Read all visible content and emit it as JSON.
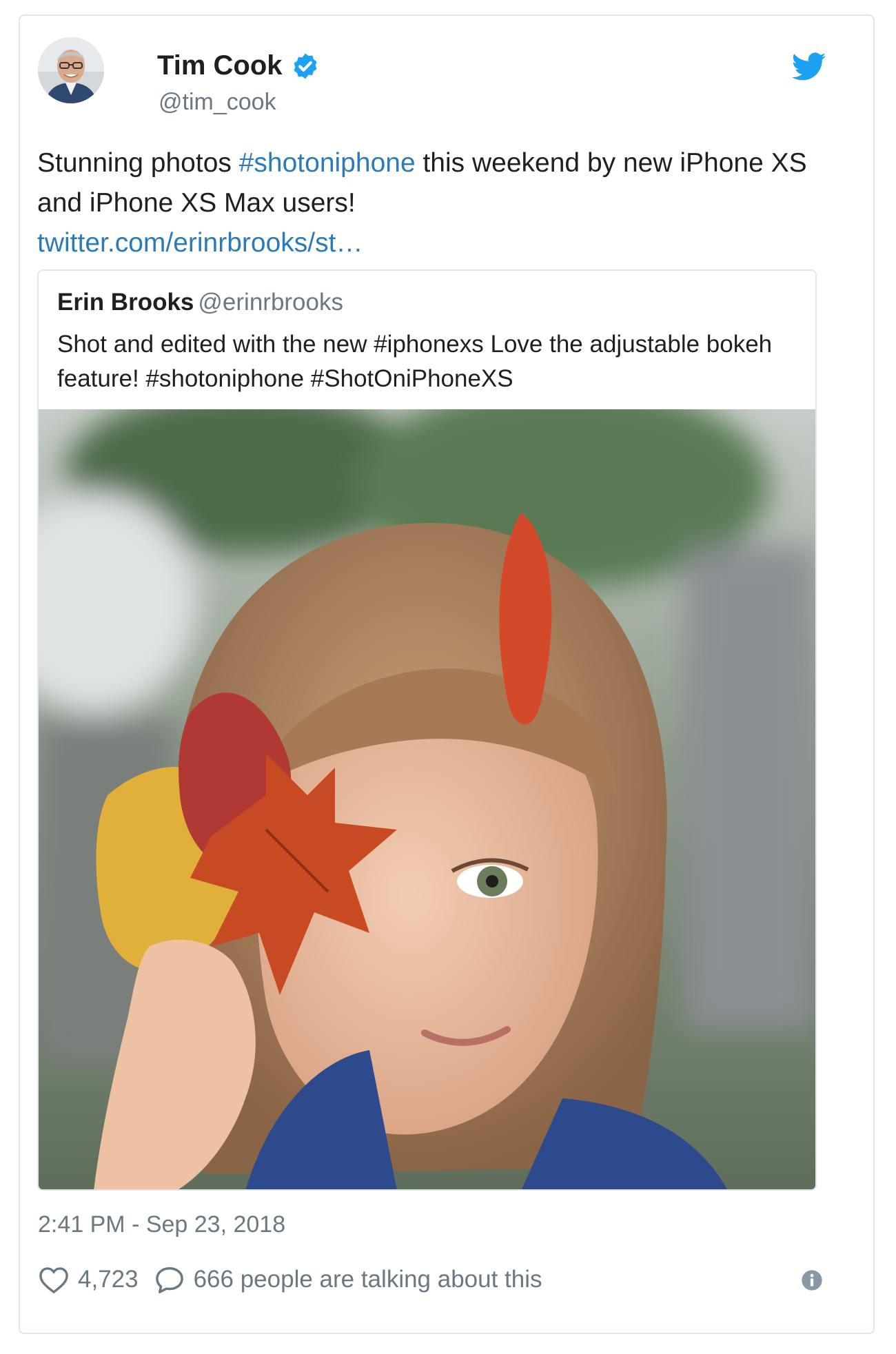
{
  "author": {
    "name": "Tim Cook",
    "handle": "@tim_cook",
    "verified": true
  },
  "tweet": {
    "text_before": "Stunning photos ",
    "hashtag": "#shotoniphone",
    "text_after": " this weekend by new iPhone XS and iPhone XS Max users!",
    "link": "twitter.com/erinrbrooks/st…"
  },
  "quote": {
    "name": "Erin Brooks",
    "handle": "@erinrbrooks",
    "text": "Shot and edited with the new #iphonexs Love the adjustable bokeh feature! #shotoniphone #ShotOniPhoneXS"
  },
  "timestamp": "2:41 PM - Sep 23, 2018",
  "actions": {
    "likes": "4,723",
    "talking": "666 people are talking about this"
  },
  "icons": {
    "brand": "twitter-bird-icon",
    "verified": "verified-badge-icon",
    "like": "heart-icon",
    "reply": "speech-bubble-icon",
    "info": "info-icon"
  },
  "colors": {
    "link": "#2b7bb9",
    "twitter_blue": "#1da1f2",
    "secondary_text": "#697882",
    "border": "#e1e8ed"
  }
}
